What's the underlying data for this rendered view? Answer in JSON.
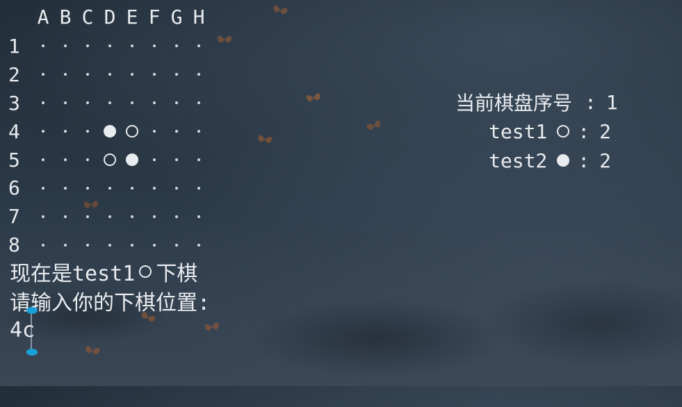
{
  "board": {
    "columns": [
      "A",
      "B",
      "C",
      "D",
      "E",
      "F",
      "G",
      "H"
    ],
    "rows": [
      {
        "label": "1",
        "cells": [
          ".",
          ".",
          ".",
          ".",
          ".",
          ".",
          ".",
          "."
        ]
      },
      {
        "label": "2",
        "cells": [
          ".",
          ".",
          ".",
          ".",
          ".",
          ".",
          ".",
          "."
        ]
      },
      {
        "label": "3",
        "cells": [
          ".",
          ".",
          ".",
          ".",
          ".",
          ".",
          ".",
          "."
        ]
      },
      {
        "label": "4",
        "cells": [
          ".",
          ".",
          ".",
          "black",
          "white",
          ".",
          ".",
          "."
        ]
      },
      {
        "label": "5",
        "cells": [
          ".",
          ".",
          ".",
          "white",
          "black",
          ".",
          ".",
          "."
        ]
      },
      {
        "label": "6",
        "cells": [
          ".",
          ".",
          ".",
          ".",
          ".",
          ".",
          ".",
          "."
        ]
      },
      {
        "label": "7",
        "cells": [
          ".",
          ".",
          ".",
          ".",
          ".",
          ".",
          ".",
          "."
        ]
      },
      {
        "label": "8",
        "cells": [
          ".",
          ".",
          ".",
          ".",
          ".",
          ".",
          ".",
          "."
        ]
      }
    ]
  },
  "status": {
    "board_label": "当前棋盘序号",
    "colon": ":",
    "board_number": "1",
    "players": [
      {
        "name": "test1",
        "piece": "white",
        "score": "2"
      },
      {
        "name": "test2",
        "piece": "black",
        "score": "2"
      }
    ]
  },
  "prompt": {
    "turn_prefix": "现在是test1",
    "turn_piece": "white",
    "turn_suffix": "下棋",
    "question": "请输入你的下棋位置:",
    "input_value": "4c"
  },
  "colors": {
    "text": "#e9ecef",
    "cursor_accent": "#1aa0d8"
  }
}
